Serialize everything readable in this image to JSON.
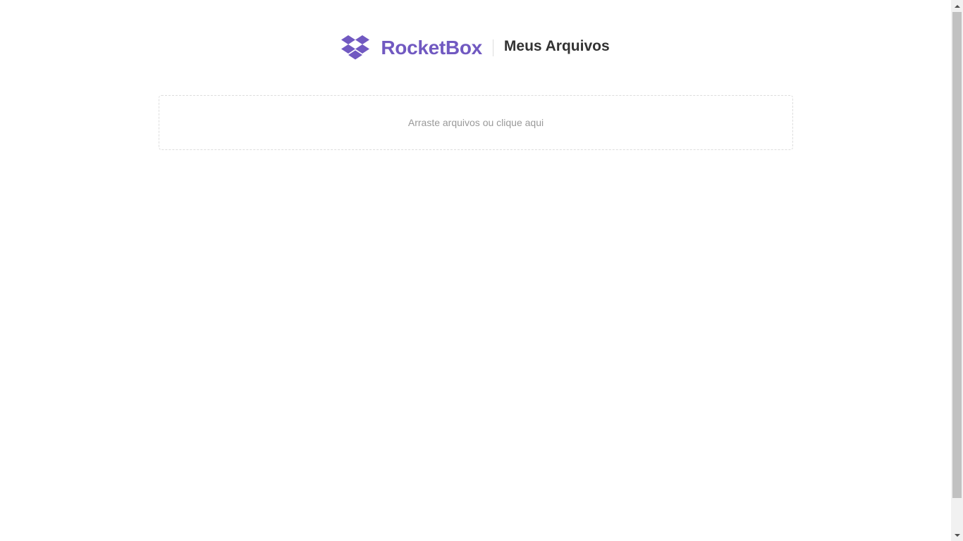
{
  "header": {
    "brand": "RocketBox",
    "title": "Meus Arquivos",
    "logo_icon": "dropbox-box-icon",
    "brand_color": "#7159c1"
  },
  "dropzone": {
    "label": "Arraste arquivos ou clique aqui"
  },
  "scrollbar": {
    "up_icon": "arrow-up-icon",
    "down_icon": "arrow-down-icon"
  }
}
